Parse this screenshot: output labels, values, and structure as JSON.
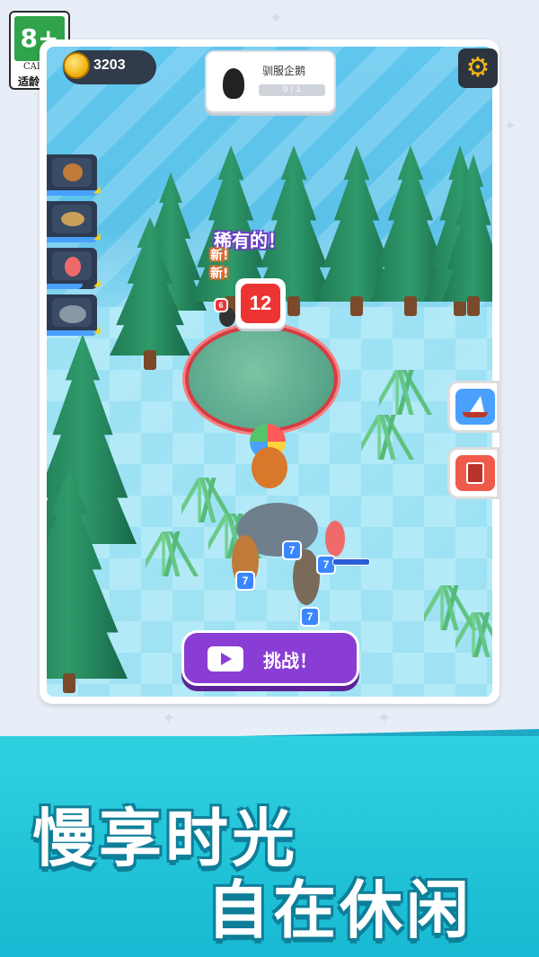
{
  "age_rating": {
    "age": "8+",
    "org": "CADPA",
    "note": "适龄提示"
  },
  "hud": {
    "coins": "3203",
    "quest": {
      "title": "驯服企鹅",
      "progress": "0 / 1"
    }
  },
  "scene": {
    "rare_label": "稀有的！",
    "new_label": "新!",
    "enemy_level": "12",
    "ally_small_level": "6",
    "ally_levels": [
      "7",
      "7",
      "7",
      "7"
    ]
  },
  "buttons": {
    "challenge_label": "挑战！"
  },
  "banner": {
    "line1": "慢享时光",
    "line2": "自在休闲"
  },
  "icons": [
    "coin-icon",
    "gear-icon",
    "boat-icon",
    "book-icon",
    "video-icon"
  ]
}
